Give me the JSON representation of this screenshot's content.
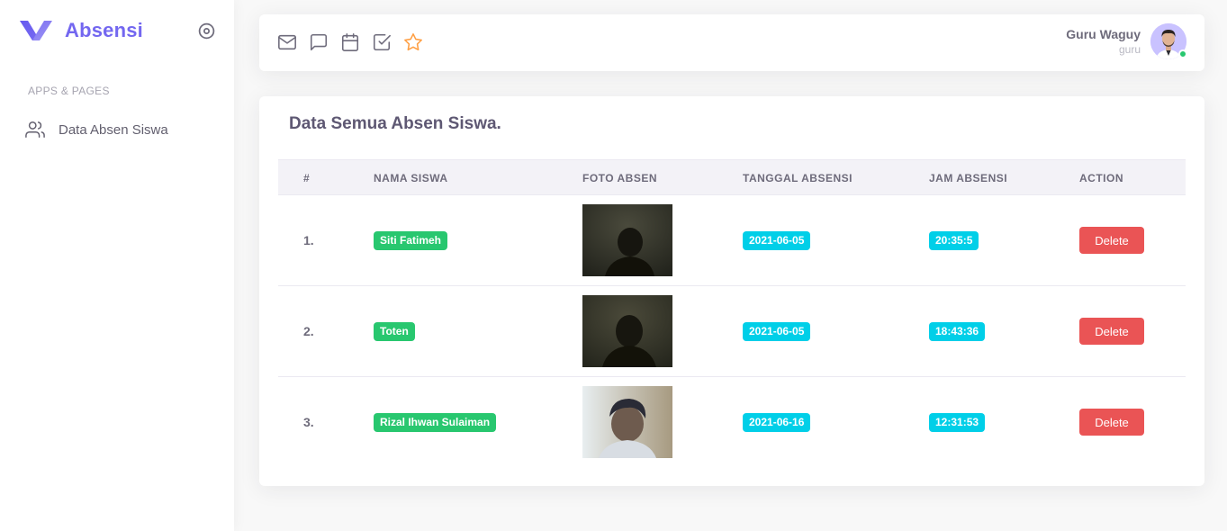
{
  "brand": {
    "name": "Absensi",
    "color": "#7367f0"
  },
  "sidebar": {
    "section_header": "APPS & PAGES",
    "items": [
      {
        "label": "Data Absen Siswa",
        "icon": "users-icon"
      }
    ]
  },
  "navbar": {
    "icons": [
      "mail-icon",
      "message-square-icon",
      "calendar-icon",
      "check-square-icon",
      "star-icon"
    ],
    "user": {
      "name": "Guru Waguy",
      "role": "guru"
    }
  },
  "card": {
    "title": "Data Semua Absen Siswa.",
    "columns": [
      "#",
      "NAMA SISWA",
      "FOTO ABSEN",
      "TANGGAL ABSENSI",
      "JAM ABSENSI",
      "ACTION"
    ],
    "rows": [
      {
        "num": "1.",
        "name": "Siti Fatimeh",
        "date": "2021-06-05",
        "time": "20:35:5",
        "action": "Delete"
      },
      {
        "num": "2.",
        "name": "Toten",
        "date": "2021-06-05",
        "time": "18:43:36",
        "action": "Delete"
      },
      {
        "num": "3.",
        "name": "Rizal Ihwan Sulaiman",
        "date": "2021-06-16",
        "time": "12:31:53",
        "action": "Delete"
      }
    ]
  },
  "colors": {
    "success": "#28c76f",
    "info": "#00cfe8",
    "danger": "#ea5455",
    "warning": "#ff9f43"
  }
}
